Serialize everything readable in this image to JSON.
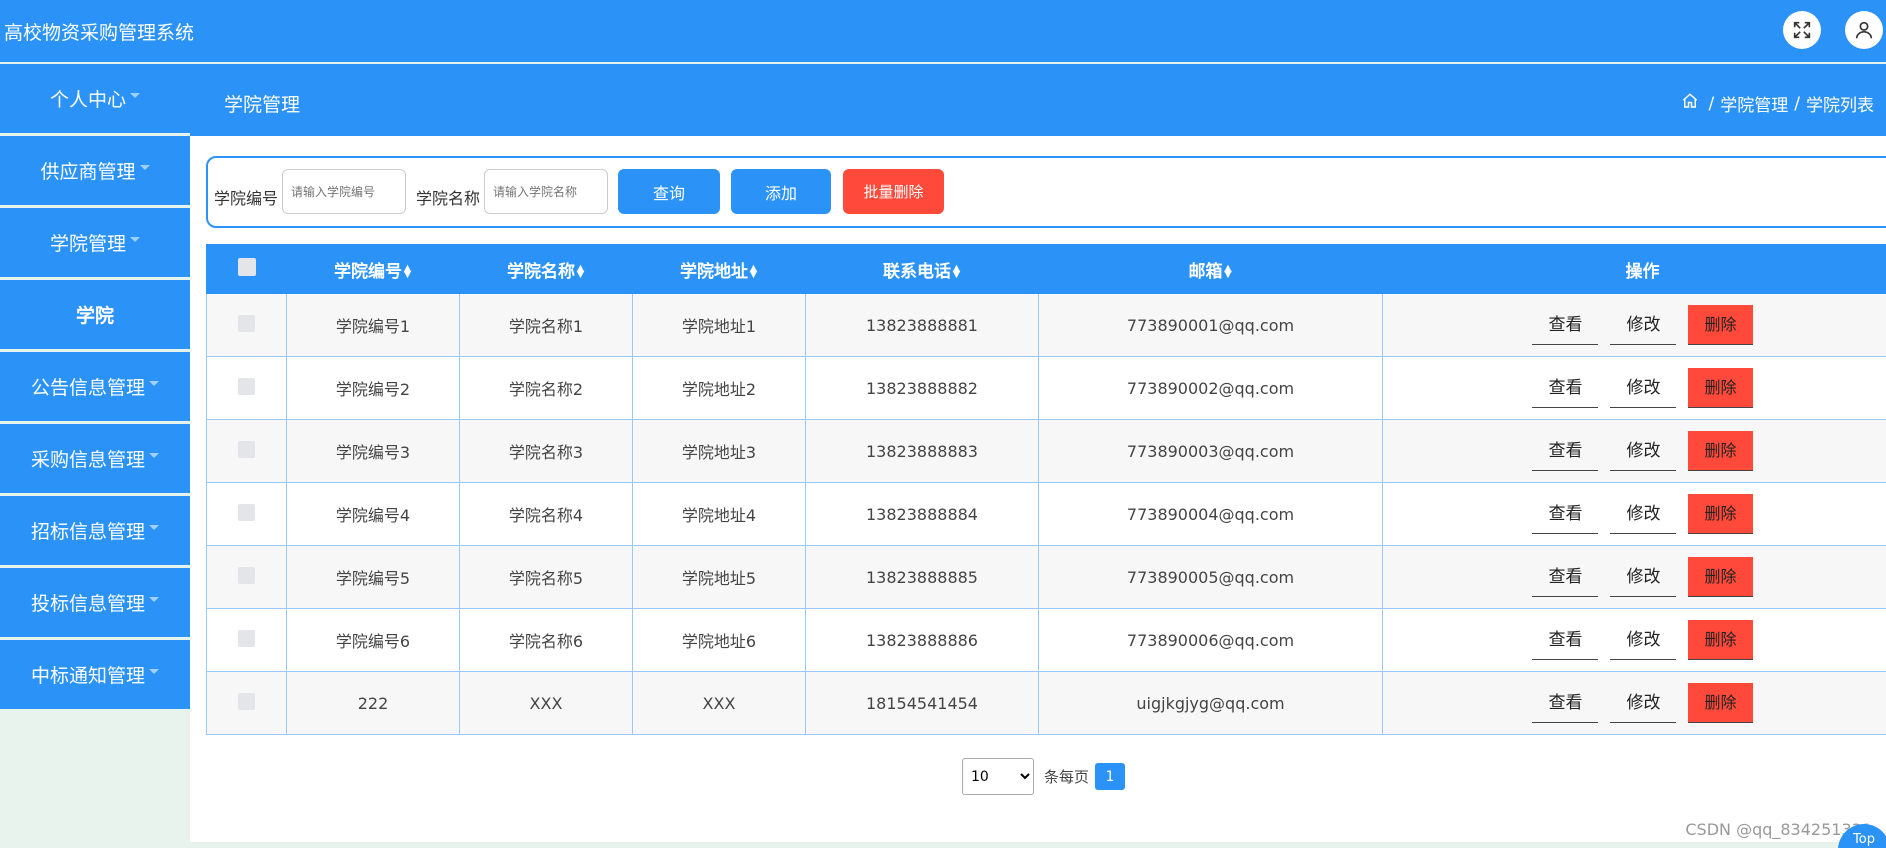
{
  "app": {
    "title": "高校物资采购管理系统"
  },
  "sidebar": {
    "items": [
      {
        "label": "个人中心",
        "caret": true
      },
      {
        "label": "供应商管理",
        "caret": true
      },
      {
        "label": "学院管理",
        "caret": true
      },
      {
        "label": "学院",
        "caret": false,
        "active": true
      },
      {
        "label": "公告信息管理",
        "caret": true
      },
      {
        "label": "采购信息管理",
        "caret": true
      },
      {
        "label": "招标信息管理",
        "caret": true
      },
      {
        "label": "投标信息管理",
        "caret": true
      },
      {
        "label": "中标通知管理",
        "caret": true
      }
    ]
  },
  "header": {
    "section_title": "学院管理",
    "breadcrumb": [
      "学院管理",
      "学院列表"
    ]
  },
  "search": {
    "code_label": "学院编号",
    "code_placeholder": "请输入学院编号",
    "name_label": "学院名称",
    "name_placeholder": "请输入学院名称",
    "query_label": "查询",
    "add_label": "添加",
    "batch_delete_label": "批量删除"
  },
  "table": {
    "columns": [
      "学院编号",
      "学院名称",
      "学院地址",
      "联系电话",
      "邮箱",
      "操作"
    ],
    "rows": [
      {
        "code": "学院编号1",
        "name": "学院名称1",
        "address": "学院地址1",
        "phone": "13823888881",
        "email": "773890001@qq.com"
      },
      {
        "code": "学院编号2",
        "name": "学院名称2",
        "address": "学院地址2",
        "phone": "13823888882",
        "email": "773890002@qq.com"
      },
      {
        "code": "学院编号3",
        "name": "学院名称3",
        "address": "学院地址3",
        "phone": "13823888883",
        "email": "773890003@qq.com"
      },
      {
        "code": "学院编号4",
        "name": "学院名称4",
        "address": "学院地址4",
        "phone": "13823888884",
        "email": "773890004@qq.com"
      },
      {
        "code": "学院编号5",
        "name": "学院名称5",
        "address": "学院地址5",
        "phone": "13823888885",
        "email": "773890005@qq.com"
      },
      {
        "code": "学院编号6",
        "name": "学院名称6",
        "address": "学院地址6",
        "phone": "13823888886",
        "email": "773890006@qq.com"
      },
      {
        "code": "222",
        "name": "XXX",
        "address": "XXX",
        "phone": "18154541454",
        "email": "uigjkgjyg@qq.com"
      }
    ],
    "actions": {
      "view": "查看",
      "edit": "修改",
      "delete": "删除"
    }
  },
  "pagination": {
    "page_size": "10",
    "per_page_label": "条每页",
    "current_page": "1"
  },
  "footer": {
    "watermark": "CSDN @qq_834251331",
    "top_label": "Top"
  },
  "colors": {
    "primary": "#2b93f7",
    "danger": "#ff4a3b"
  }
}
